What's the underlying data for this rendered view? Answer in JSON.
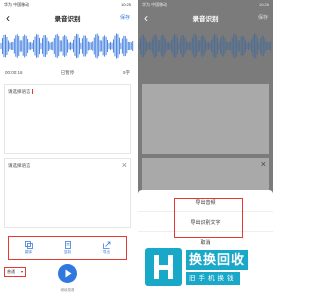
{
  "left_screen": {
    "status": {
      "left": "华为 中国移动",
      "right": "10:25"
    },
    "back_glyph": "‹",
    "title": "录音识别",
    "save_label": "保存",
    "time_current": "00:00:16",
    "paused_label": "已暂停",
    "time_total": "5字",
    "panel1_label": "请选择语言",
    "panel2_label": "请选择语言",
    "close_glyph": "×",
    "actions": [
      {
        "label": "翻译",
        "icon": "translate-icon"
      },
      {
        "label": "复制",
        "icon": "copy-icon"
      },
      {
        "label": "导出",
        "icon": "export-icon"
      }
    ],
    "language_select": {
      "value": "普通",
      "arrow": "▾"
    },
    "record_hint": "继续录音"
  },
  "right_screen": {
    "status": {
      "left": "华为 中国移动",
      "right": "10:26"
    },
    "back_glyph": "‹",
    "title": "录音识别",
    "save_label": "保存",
    "close_glyph": "×",
    "menu": {
      "items": [
        "导出音频",
        "导出识别文字"
      ],
      "cancel": "取消"
    }
  },
  "watermark": {
    "logo_letter": "H",
    "main_text": "换换回收",
    "sub_text": "旧手机换钱",
    "color": "#1aa8c9"
  },
  "colors": {
    "accent": "#3b7be0",
    "highlight": "#e53935",
    "overlay": "#7b7b7b"
  }
}
